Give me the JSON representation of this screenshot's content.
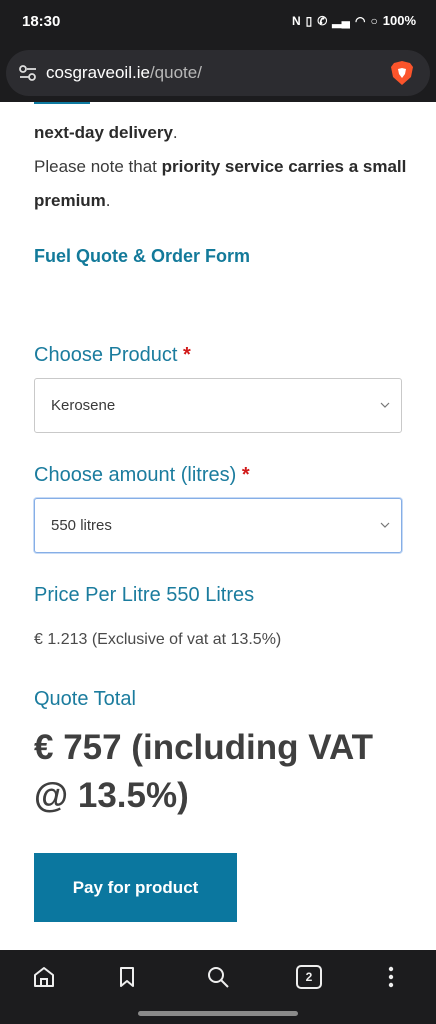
{
  "status": {
    "time": "18:30",
    "battery": "100%"
  },
  "browser": {
    "url_domain": "cosgraveoil.ie",
    "url_path": "/quote/",
    "tab_count": "2"
  },
  "intro": {
    "line1_bold": "next-day delivery",
    "line1_end": ".",
    "line2_start": "Please note that ",
    "line2_bold": "priority service carries a small premium",
    "line2_end": "."
  },
  "form": {
    "title": "Fuel Quote & Order Form",
    "product_label": "Choose Product",
    "product_value": "Kerosene",
    "amount_label": "Choose amount (litres)",
    "amount_value": "550 litres",
    "required_mark": "*"
  },
  "price": {
    "label": "Price Per Litre 550 Litres",
    "value": "€ 1.213 (Exclusive of vat at 13.5%)"
  },
  "quote": {
    "label": "Quote Total",
    "value": "€ 757 (including VAT @ 13.5%)"
  },
  "pay_button": "Pay for product",
  "colors": {
    "accent": "#137a9a",
    "button": "#0b779f",
    "required": "#d11a1a"
  }
}
